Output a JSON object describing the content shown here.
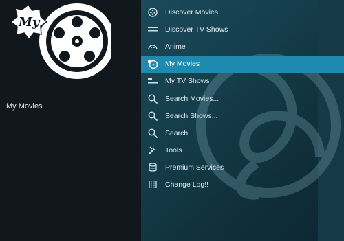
{
  "left_panel": {
    "logo_text": "My",
    "selected_label": "My Movies"
  },
  "menu": {
    "items": [
      {
        "label": "Discover Movies",
        "icon": "film-reel-icon"
      },
      {
        "label": "Discover TV Shows",
        "icon": "tv-bars-icon"
      },
      {
        "label": "Anime",
        "icon": "anime-icon"
      },
      {
        "label": "My Movies",
        "icon": "my-reel-icon",
        "active": true
      },
      {
        "label": "My TV Shows",
        "icon": "my-tv-icon"
      },
      {
        "label": "Search Movies...",
        "icon": "search-icon"
      },
      {
        "label": "Search Shows...",
        "icon": "search-icon"
      },
      {
        "label": "Search",
        "icon": "search-icon"
      },
      {
        "label": "Tools",
        "icon": "tools-icon"
      },
      {
        "label": "Premium Services",
        "icon": "database-icon"
      },
      {
        "label": "Change Log!!",
        "icon": "changelog-icon"
      }
    ]
  },
  "colors": {
    "active_item": "#1e8ab0",
    "left_panel_bg": "#11181d",
    "right_panel_bg": "#16404e"
  }
}
